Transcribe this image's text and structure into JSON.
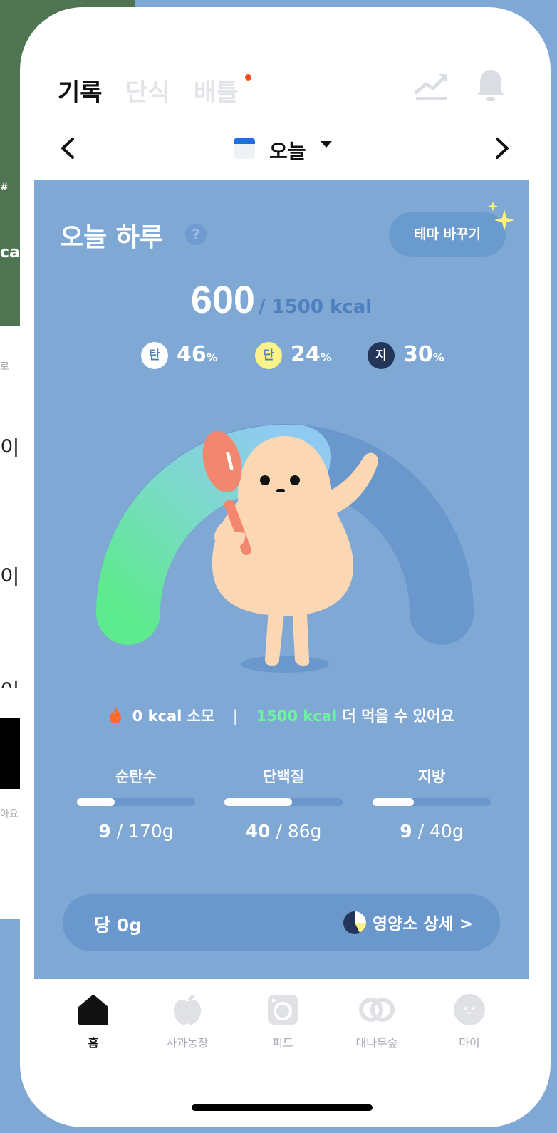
{
  "background_screen": {
    "fragments": [
      "ca",
      "로",
      "이",
      "이",
      "이",
      "아요",
      "#"
    ]
  },
  "header": {
    "tabs": [
      {
        "label": "기록",
        "active": true
      },
      {
        "label": "단식",
        "active": false
      },
      {
        "label": "배틀",
        "active": false,
        "has_dot": true
      }
    ],
    "icons": [
      "trend-icon",
      "bell-icon"
    ]
  },
  "date_nav": {
    "label": "오늘",
    "icons": [
      "chevron-left-icon",
      "calendar-icon",
      "caret-down-icon",
      "chevron-right-icon"
    ]
  },
  "card": {
    "title": "오늘 하루",
    "help_glyph": "?",
    "theme_button": "테마 바꾸기",
    "calories": {
      "eaten": "600",
      "goal_text": "/ 1500 kcal",
      "eaten_value": 600,
      "goal_value": 1500
    },
    "macro_ratio": [
      {
        "badge": "탄",
        "percent": "46",
        "unit": "%",
        "badge_color": "#ffffff",
        "badge_text_color": "#4e7fbe"
      },
      {
        "badge": "단",
        "percent": "24",
        "unit": "%",
        "badge_color": "#fbf28a",
        "badge_text_color": "#4e7fbe"
      },
      {
        "badge": "지",
        "percent": "30",
        "unit": "%",
        "badge_color": "#24355a",
        "badge_text_color": "#ffffff"
      }
    ],
    "burn": {
      "burned": "0 kcal",
      "burned_suffix": "소모",
      "separator": "|",
      "remaining": "1500 kcal",
      "remaining_suffix": "더 먹을 수 있어요"
    },
    "nutrients": [
      {
        "name": "순탄수",
        "current": "9",
        "total": "/ 170g",
        "fill": 0.32
      },
      {
        "name": "단백질",
        "current": "40",
        "total": "/ 86g",
        "fill": 0.57
      },
      {
        "name": "지방",
        "current": "9",
        "total": "/ 40g",
        "fill": 0.35
      }
    ],
    "sugar": "당 0g",
    "detail_link": "영양소 상세 >"
  },
  "bottom_nav": [
    {
      "label": "홈",
      "icon": "home-icon",
      "active": true
    },
    {
      "label": "사과농장",
      "icon": "apple-icon",
      "active": false
    },
    {
      "label": "피드",
      "icon": "camera-icon",
      "active": false
    },
    {
      "label": "대나무숲",
      "icon": "bamboo-icon",
      "active": false
    },
    {
      "label": "마이",
      "icon": "profile-icon",
      "active": false
    }
  ],
  "colors": {
    "accent_blue": "#7fa8d4",
    "remaining_green": "#6ef2a0",
    "notification_dot": "#ff4a1c"
  }
}
